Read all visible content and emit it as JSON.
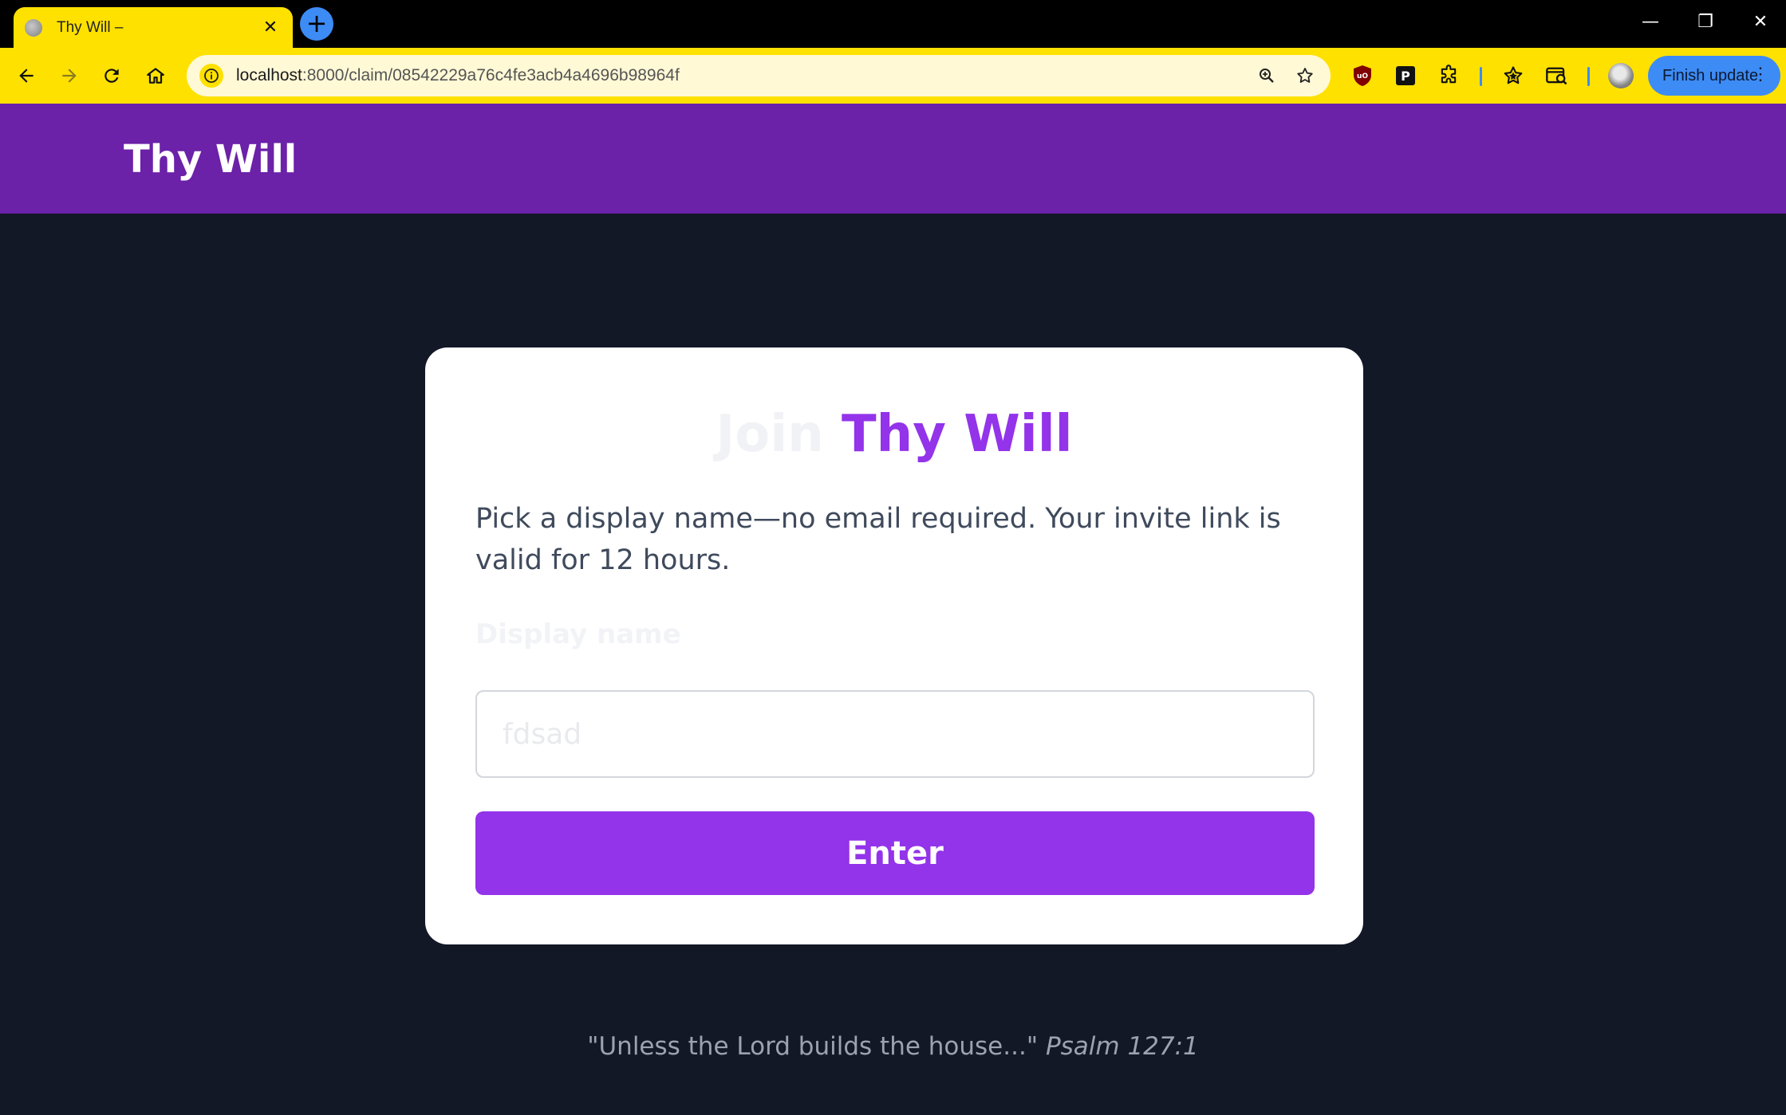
{
  "browser": {
    "tab_title": "Thy Will –",
    "tab_close": "✕",
    "new_tab": "+",
    "url_host": "localhost",
    "url_path": ":8000/claim/08542229a76c4fe3acb4a4696b98964f",
    "finish_update_label": "Finish update",
    "window_controls": {
      "minimize": "—",
      "restore": "❐",
      "close": "✕"
    },
    "theme_color": "#FFE100",
    "accent_color": "#3D8BF5",
    "extensions": [
      "ublock-origin-icon",
      "p-extension-icon",
      "extensions-puzzle-icon",
      "bookmark-star-icon",
      "tab-search-icon"
    ]
  },
  "header": {
    "brand": "Thy Will",
    "color": "#6B21A8"
  },
  "card": {
    "title_prefix": "Join",
    "title_brand": "Thy Will",
    "intro": "Pick a display name—no email required. Your invite link is valid for 12 hours.",
    "field_label": "Display name",
    "input_value": "fdsad",
    "submit_label": "Enter",
    "accent_color": "#9333EA"
  },
  "footer": {
    "quote": "\"Unless the Lord builds the house...\"",
    "reference": "Psalm 127:1"
  }
}
